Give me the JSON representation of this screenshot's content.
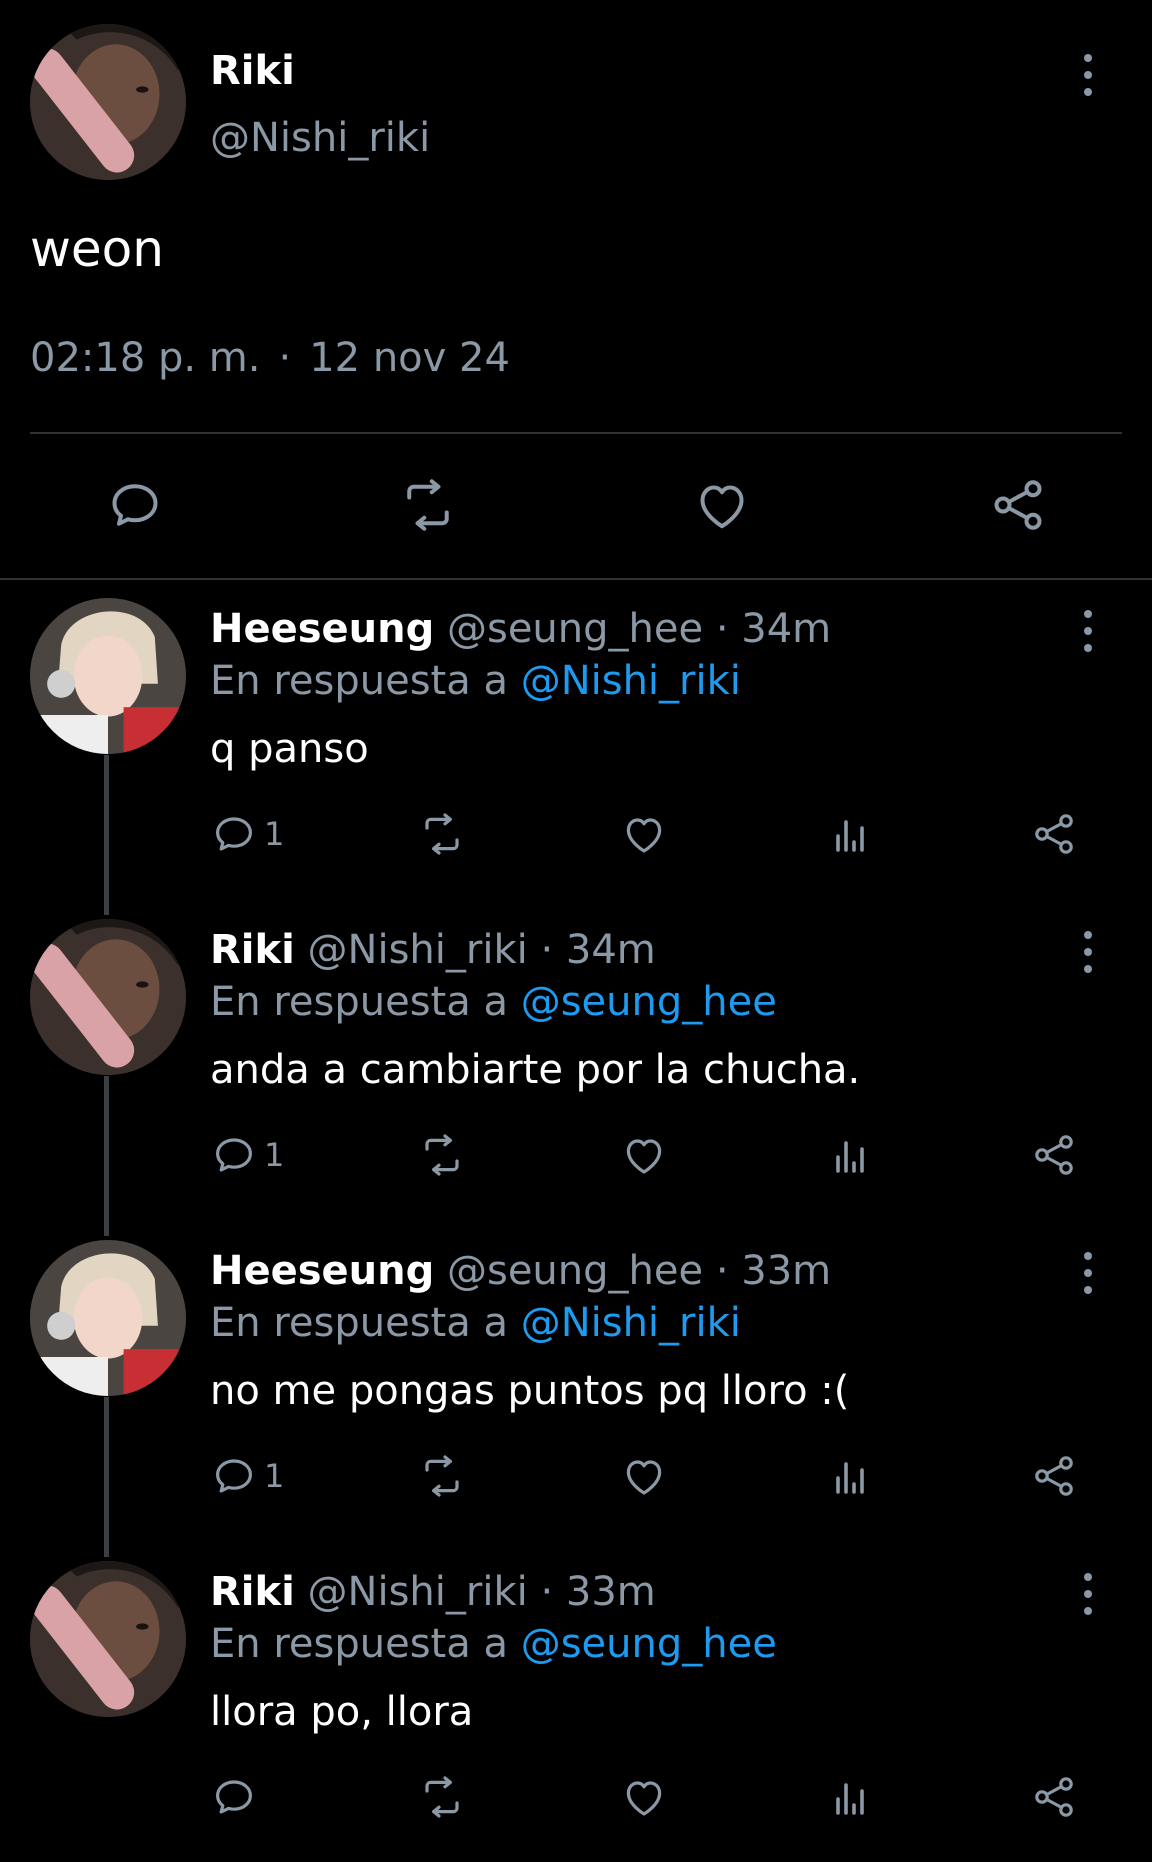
{
  "main_tweet": {
    "name": "Riki",
    "handle": "@Nishi_riki",
    "text": "weon",
    "time": "02:18 p. m.",
    "separator": "·",
    "date": "12 nov 24",
    "actions": [
      "reply-icon",
      "retweet-icon",
      "like-icon",
      "share-icon"
    ]
  },
  "replies": [
    {
      "name": "Heeseung",
      "handle": "@seung_hee",
      "time": "· 34m",
      "reply_prefix": "En respuesta a",
      "reply_to": "@Nishi_riki",
      "text": "q panso",
      "reply_count": "1"
    },
    {
      "name": "Riki",
      "handle": "@Nishi_riki",
      "time": "· 34m",
      "reply_prefix": "En respuesta a",
      "reply_to": "@seung_hee",
      "text": "anda a cambiarte por la chucha.",
      "reply_count": "1"
    },
    {
      "name": "Heeseung",
      "handle": "@seung_hee",
      "time": "· 33m",
      "reply_prefix": "En respuesta a",
      "reply_to": "@Nishi_riki",
      "text": "no me pongas puntos pq lloro :(",
      "reply_count": "1"
    },
    {
      "name": "Riki",
      "handle": "@Nishi_riki",
      "time": "· 33m",
      "reply_prefix": "En respuesta a",
      "reply_to": "@seung_hee",
      "text": "llora po, llora",
      "reply_count": ""
    }
  ],
  "colors": {
    "background": "#000000",
    "secondary_text": "#8b98a5",
    "mention": "#1d9bf0",
    "divider": "#2f3336"
  }
}
